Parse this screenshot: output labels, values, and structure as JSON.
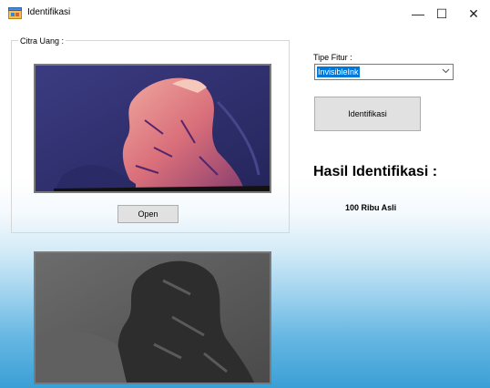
{
  "window": {
    "title": "Identifikasi",
    "minimize_glyph": "—",
    "maximize_glyph": "☐",
    "close_glyph": "✕"
  },
  "group": {
    "label": "Citra Uang :"
  },
  "buttons": {
    "open_label": "Open",
    "identify_label": "Identifikasi"
  },
  "feature": {
    "label": "Tipe Fitur :",
    "selected": "InvisibleInk"
  },
  "result": {
    "heading": "Hasil Identifikasi :",
    "value": "100 Ribu Asli"
  },
  "icons": {
    "app": "app-window-icon",
    "dropdown": "chevron-down-icon"
  },
  "colors": {
    "selection": "#0078d7",
    "gradient_bottom": "#3a9fd6"
  }
}
